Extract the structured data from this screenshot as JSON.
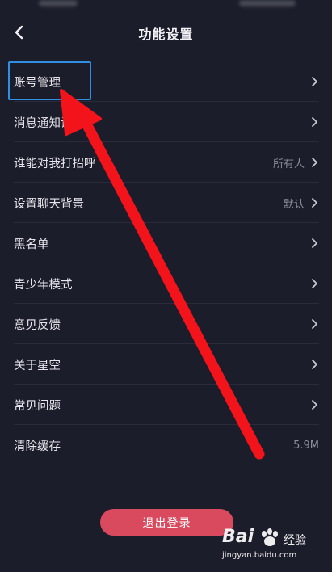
{
  "header": {
    "title": "功能设置",
    "back_icon": "chevron-left-icon"
  },
  "settings": [
    {
      "label": "账号管理",
      "value": "",
      "chevron": true
    },
    {
      "label": "消息通知设置",
      "value": "",
      "chevron": true
    },
    {
      "label": "谁能对我打招呼",
      "value": "所有人",
      "chevron": true
    },
    {
      "label": "设置聊天背景",
      "value": "默认",
      "chevron": true
    },
    {
      "label": "黑名单",
      "value": "",
      "chevron": true
    },
    {
      "label": "青少年模式",
      "value": "",
      "chevron": true
    },
    {
      "label": "意见反馈",
      "value": "",
      "chevron": true
    },
    {
      "label": "关于星空",
      "value": "",
      "chevron": true
    },
    {
      "label": "常见问题",
      "value": "",
      "chevron": true
    },
    {
      "label": "清除缓存",
      "value": "5.9M",
      "chevron": false
    }
  ],
  "logout": {
    "label": "退出登录"
  },
  "annotation": {
    "box_color": "#2f8fe0",
    "arrow_color": "#f2131b"
  },
  "colors": {
    "background": "#1c1d2b",
    "logout": "#d94a5f"
  },
  "watermark": {
    "brand": "Bai",
    "suffix": "经验",
    "url": "jingyan.baidu.com"
  }
}
